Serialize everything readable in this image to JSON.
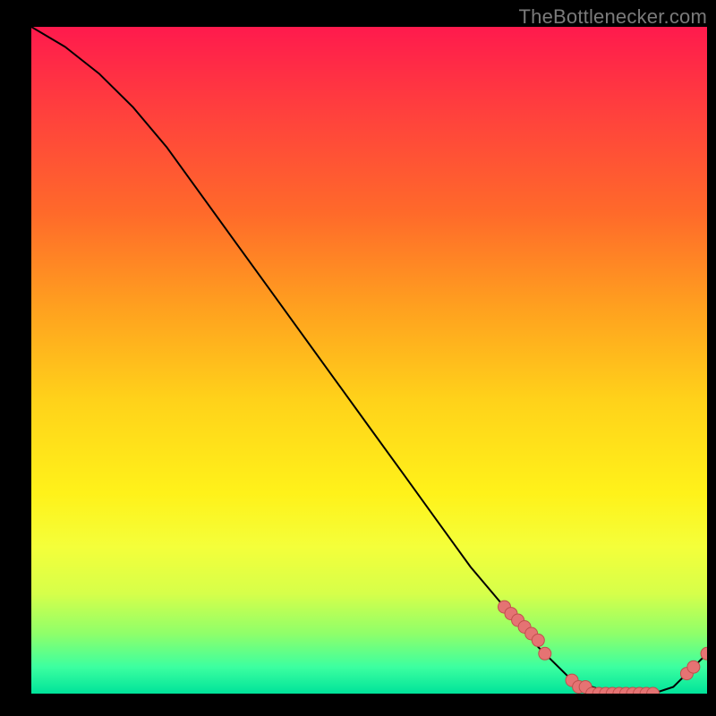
{
  "watermark": "TheBottlenecker.com",
  "chart_data": {
    "type": "line",
    "title": "",
    "xlabel": "",
    "ylabel": "",
    "xlim": [
      0,
      100
    ],
    "ylim": [
      0,
      100
    ],
    "grid": false,
    "legend": false,
    "series": [
      {
        "name": "curve",
        "x": [
          0,
          5,
          10,
          15,
          20,
          25,
          30,
          35,
          40,
          45,
          50,
          55,
          60,
          65,
          70,
          75,
          78,
          80,
          83,
          86,
          89,
          92,
          95,
          98,
          100
        ],
        "y": [
          100,
          97,
          93,
          88,
          82,
          75,
          68,
          61,
          54,
          47,
          40,
          33,
          26,
          19,
          13,
          7,
          4,
          2,
          1,
          0,
          0,
          0,
          1,
          4,
          6
        ]
      }
    ],
    "points": [
      {
        "x": 70,
        "y": 13
      },
      {
        "x": 71,
        "y": 12
      },
      {
        "x": 72,
        "y": 11
      },
      {
        "x": 73,
        "y": 10
      },
      {
        "x": 74,
        "y": 9
      },
      {
        "x": 75,
        "y": 8
      },
      {
        "x": 76,
        "y": 6
      },
      {
        "x": 80,
        "y": 2
      },
      {
        "x": 81,
        "y": 1
      },
      {
        "x": 82,
        "y": 1
      },
      {
        "x": 83,
        "y": 0
      },
      {
        "x": 84,
        "y": 0
      },
      {
        "x": 85,
        "y": 0
      },
      {
        "x": 86,
        "y": 0
      },
      {
        "x": 87,
        "y": 0
      },
      {
        "x": 88,
        "y": 0
      },
      {
        "x": 89,
        "y": 0
      },
      {
        "x": 90,
        "y": 0
      },
      {
        "x": 91,
        "y": 0
      },
      {
        "x": 92,
        "y": 0
      },
      {
        "x": 97,
        "y": 3
      },
      {
        "x": 98,
        "y": 4
      },
      {
        "x": 100,
        "y": 6
      }
    ],
    "colors": {
      "line": "#000000",
      "point_fill": "#e57373",
      "point_stroke": "#c0504d"
    }
  }
}
